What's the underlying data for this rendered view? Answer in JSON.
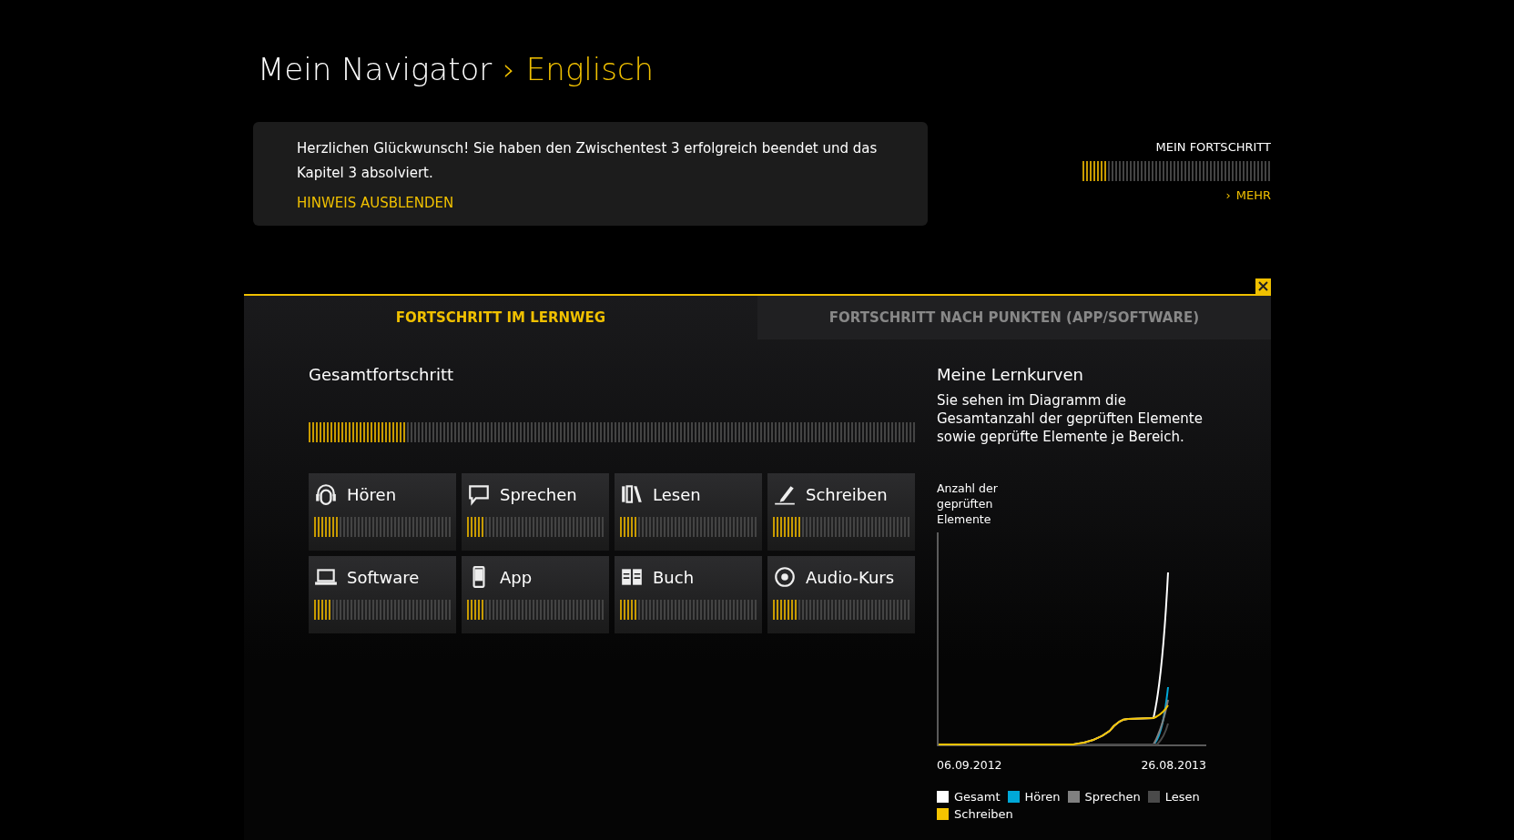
{
  "breadcrumb": {
    "root": "Mein Navigator",
    "separator": "›",
    "current": "Englisch"
  },
  "notice": {
    "text": "Herzlichen Glückwunsch! Sie haben den Zwischentest 3 erfolgreich beendet und das Kapitel 3 absolviert.",
    "link": "HINWEIS AUSBLENDEN"
  },
  "my_progress": {
    "label": "MEIN FORTSCHRITT",
    "level": 0.125,
    "more_icon": "›",
    "more": "MEHR"
  },
  "tabs": [
    {
      "label": "FORTSCHRITT IM LERNWEG",
      "selected": true
    },
    {
      "label": "FORTSCHRITT NACH PUNKTEN (APP/SOFTWARE)",
      "selected": false
    }
  ],
  "overall": {
    "title": "Gesamtfortschritt",
    "level": 0.16
  },
  "skills": [
    {
      "kind": "headphones",
      "label": "Hören",
      "level": 0.17
    },
    {
      "kind": "speech",
      "label": "Sprechen",
      "level": 0.13
    },
    {
      "kind": "books",
      "label": "Lesen",
      "level": 0.13
    },
    {
      "kind": "pen",
      "label": "Schreiben",
      "level": 0.21
    },
    {
      "kind": "laptop",
      "label": "Software",
      "level": 0.13
    },
    {
      "kind": "phone",
      "label": "App",
      "level": 0.13
    },
    {
      "kind": "book",
      "label": "Buch",
      "level": 0.13
    },
    {
      "kind": "disc",
      "label": "Audio-Kurs",
      "level": 0.17
    }
  ],
  "curves": {
    "title": "Meine Lernkurven",
    "description": "Sie sehen im Diagramm die Gesamtanzahl der geprüften Elemente sowie geprüfte Elemente je Bereich.",
    "ylabel": "Anzahl der geprüften Elemente",
    "x_start": "06.09.2012",
    "x_end": "26.08.2013",
    "legend": [
      {
        "label": "Gesamt",
        "color": "#ffffff"
      },
      {
        "label": "Hören",
        "color": "#00a8d8"
      },
      {
        "label": "Sprechen",
        "color": "#808080"
      },
      {
        "label": "Lesen",
        "color": "#4a4a4a"
      },
      {
        "label": "Schreiben",
        "color": "#f5c400"
      }
    ]
  }
}
